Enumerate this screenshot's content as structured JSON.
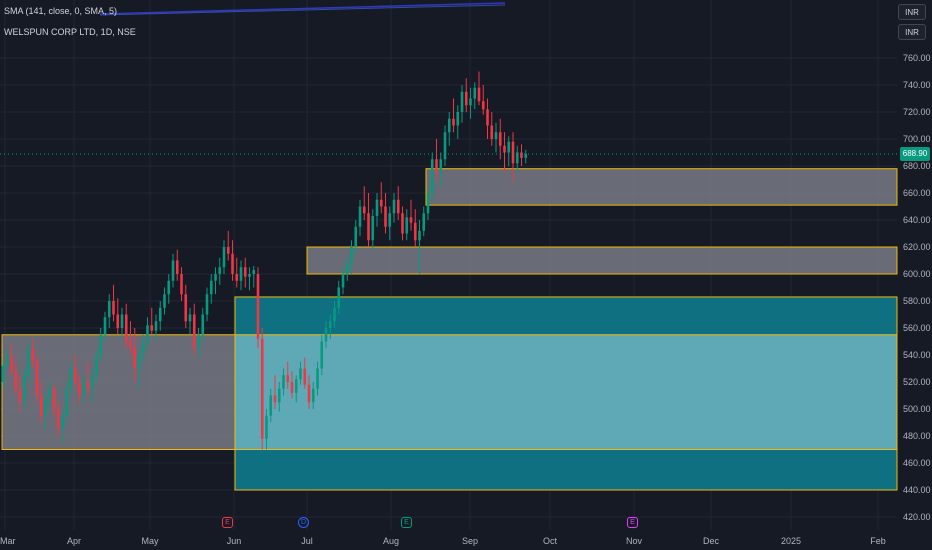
{
  "symbol": {
    "title": "WELSPUN CORP LTD, 1D, NSE",
    "indicator": "SMA (141, close, 0, SMA, 5)"
  },
  "currency_buttons": [
    "INR",
    "INR"
  ],
  "last_price": "688.90",
  "colors": {
    "up": "#089981",
    "down": "#f23645",
    "zone_gray": "#787b86",
    "zone_teal": "#0f7082",
    "zone_light_teal": "#5fa9b6",
    "zone_border": "#f0b90b",
    "background": "#161a25"
  },
  "price_axis": {
    "ticks": [
      760,
      740,
      720,
      700,
      680,
      660,
      640,
      620,
      600,
      580,
      560,
      540,
      520,
      500,
      480,
      460,
      440,
      420
    ],
    "labels": [
      "760.00",
      "740.00",
      "720.00",
      "700.00",
      "680.00",
      "660.00",
      "640.00",
      "620.00",
      "600.00",
      "580.00",
      "560.00",
      "540.00",
      "520.00",
      "500.00",
      "480.00",
      "460.00",
      "440.00",
      "420.00"
    ]
  },
  "time_axis": {
    "labels": [
      "Mar",
      "Apr",
      "May",
      "Jun",
      "Jul",
      "Aug",
      "Sep",
      "Oct",
      "Nov",
      "Dec",
      "2025",
      "Feb"
    ]
  },
  "events": [
    {
      "type": "earnings",
      "glyph": "E",
      "date": "May-late"
    },
    {
      "type": "dividend",
      "glyph": "D",
      "date": "Jul"
    },
    {
      "type": "earnings-green",
      "glyph": "E",
      "date": "Aug"
    },
    {
      "type": "earnings-future",
      "glyph": "E",
      "date": "Nov"
    }
  ],
  "chart_data": {
    "type": "candlestick",
    "title": "WELSPUN CORP LTD, 1D, NSE",
    "ylim": [
      415,
      775
    ],
    "zones": [
      {
        "kind": "gray",
        "from_date": "Mar",
        "to_date": "Jun",
        "top": 555,
        "bottom": 470
      },
      {
        "kind": "teal",
        "from_date": "Jun",
        "to_date": "Feb",
        "top": 583,
        "bottom": 440
      },
      {
        "kind": "light_teal",
        "from_date": "Jun",
        "to_date": "Feb",
        "top": 555,
        "bottom": 470
      },
      {
        "kind": "gray",
        "from_date": "Jul",
        "to_date": "Feb",
        "top": 620,
        "bottom": 600
      },
      {
        "kind": "gray",
        "from_date": "Aug",
        "to_date": "Feb",
        "top": 678,
        "bottom": 651
      }
    ],
    "candles": [
      [
        520,
        535,
        515,
        532
      ],
      [
        532,
        545,
        528,
        540
      ],
      [
        540,
        548,
        525,
        528
      ],
      [
        528,
        535,
        510,
        515
      ],
      [
        515,
        525,
        498,
        505
      ],
      [
        505,
        530,
        500,
        525
      ],
      [
        525,
        550,
        520,
        545
      ],
      [
        545,
        552,
        530,
        535
      ],
      [
        535,
        540,
        505,
        510
      ],
      [
        510,
        520,
        490,
        495
      ],
      [
        495,
        512,
        485,
        508
      ],
      [
        508,
        520,
        500,
        515
      ],
      [
        515,
        518,
        495,
        500
      ],
      [
        500,
        505,
        480,
        485
      ],
      [
        485,
        500,
        475,
        495
      ],
      [
        495,
        520,
        490,
        515
      ],
      [
        515,
        535,
        510,
        530
      ],
      [
        530,
        540,
        515,
        520
      ],
      [
        520,
        525,
        505,
        510
      ],
      [
        510,
        525,
        505,
        520
      ],
      [
        520,
        535,
        510,
        515
      ],
      [
        515,
        530,
        505,
        525
      ],
      [
        525,
        545,
        520,
        540
      ],
      [
        540,
        560,
        535,
        555
      ],
      [
        555,
        572,
        550,
        568
      ],
      [
        568,
        585,
        560,
        580
      ],
      [
        580,
        592,
        565,
        570
      ],
      [
        570,
        582,
        555,
        560
      ],
      [
        560,
        575,
        552,
        570
      ],
      [
        570,
        578,
        545,
        550
      ],
      [
        550,
        565,
        540,
        545
      ],
      [
        545,
        560,
        520,
        530
      ],
      [
        530,
        545,
        515,
        540
      ],
      [
        540,
        555,
        535,
        550
      ],
      [
        550,
        568,
        545,
        562
      ],
      [
        562,
        575,
        555,
        558
      ],
      [
        558,
        570,
        550,
        565
      ],
      [
        565,
        580,
        558,
        575
      ],
      [
        575,
        590,
        570,
        585
      ],
      [
        585,
        600,
        578,
        595
      ],
      [
        595,
        615,
        590,
        610
      ],
      [
        610,
        618,
        595,
        600
      ],
      [
        600,
        605,
        580,
        585
      ],
      [
        585,
        592,
        560,
        565
      ],
      [
        565,
        575,
        555,
        570
      ],
      [
        570,
        578,
        540,
        545
      ],
      [
        545,
        560,
        538,
        555
      ],
      [
        555,
        575,
        550,
        570
      ],
      [
        570,
        590,
        565,
        585
      ],
      [
        585,
        600,
        578,
        595
      ],
      [
        595,
        605,
        585,
        600
      ],
      [
        600,
        612,
        592,
        605
      ],
      [
        605,
        625,
        600,
        620
      ],
      [
        620,
        632,
        610,
        615
      ],
      [
        615,
        625,
        595,
        600
      ],
      [
        600,
        612,
        590,
        595
      ],
      [
        595,
        610,
        588,
        605
      ],
      [
        605,
        612,
        590,
        598
      ],
      [
        598,
        605,
        588,
        600
      ],
      [
        600,
        606,
        590,
        603
      ],
      [
        600,
        605,
        545,
        552
      ],
      [
        552,
        560,
        470,
        478
      ],
      [
        478,
        500,
        470,
        495
      ],
      [
        495,
        515,
        490,
        510
      ],
      [
        510,
        525,
        500,
        505
      ],
      [
        505,
        520,
        498,
        515
      ],
      [
        515,
        530,
        510,
        525
      ],
      [
        525,
        535,
        515,
        520
      ],
      [
        520,
        528,
        508,
        512
      ],
      [
        512,
        525,
        505,
        522
      ],
      [
        522,
        535,
        518,
        530
      ],
      [
        530,
        538,
        515,
        518
      ],
      [
        518,
        525,
        500,
        505
      ],
      [
        505,
        520,
        500,
        515
      ],
      [
        515,
        535,
        510,
        530
      ],
      [
        530,
        555,
        525,
        550
      ],
      [
        550,
        565,
        545,
        560
      ],
      [
        560,
        570,
        552,
        565
      ],
      [
        565,
        580,
        560,
        575
      ],
      [
        575,
        595,
        570,
        590
      ],
      [
        590,
        605,
        585,
        600
      ],
      [
        600,
        612,
        595,
        608
      ],
      [
        608,
        625,
        600,
        620
      ],
      [
        620,
        640,
        615,
        635
      ],
      [
        635,
        655,
        628,
        650
      ],
      [
        650,
        665,
        640,
        645
      ],
      [
        645,
        660,
        620,
        625
      ],
      [
        625,
        648,
        618,
        643
      ],
      [
        643,
        660,
        635,
        655
      ],
      [
        655,
        668,
        645,
        650
      ],
      [
        650,
        660,
        630,
        635
      ],
      [
        635,
        650,
        625,
        645
      ],
      [
        645,
        660,
        638,
        655
      ],
      [
        655,
        665,
        640,
        645
      ],
      [
        645,
        650,
        625,
        630
      ],
      [
        630,
        648,
        625,
        642
      ],
      [
        642,
        655,
        632,
        638
      ],
      [
        638,
        648,
        620,
        625
      ],
      [
        625,
        640,
        600,
        632
      ],
      [
        632,
        650,
        628,
        645
      ],
      [
        645,
        665,
        640,
        660
      ],
      [
        660,
        690,
        655,
        685
      ],
      [
        685,
        700,
        670,
        675
      ],
      [
        675,
        690,
        665,
        685
      ],
      [
        685,
        710,
        680,
        705
      ],
      [
        705,
        720,
        695,
        715
      ],
      [
        715,
        730,
        705,
        710
      ],
      [
        710,
        725,
        700,
        720
      ],
      [
        720,
        740,
        712,
        735
      ],
      [
        735,
        745,
        720,
        725
      ],
      [
        725,
        738,
        715,
        730
      ],
      [
        730,
        742,
        722,
        738
      ],
      [
        738,
        750,
        725,
        728
      ],
      [
        728,
        740,
        718,
        722
      ],
      [
        722,
        730,
        700,
        710
      ],
      [
        710,
        720,
        695,
        700
      ],
      [
        700,
        712,
        690,
        705
      ],
      [
        705,
        715,
        685,
        695
      ],
      [
        695,
        705,
        675,
        690
      ],
      [
        690,
        702,
        680,
        698
      ],
      [
        698,
        705,
        668,
        682
      ],
      [
        682,
        695,
        675,
        690
      ],
      [
        690,
        696,
        680,
        686
      ],
      [
        686,
        692,
        682,
        689
      ]
    ]
  }
}
